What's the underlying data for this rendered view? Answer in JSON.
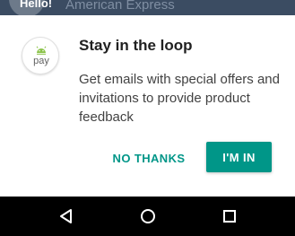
{
  "background_app": {
    "avatar_text": "Hello!",
    "title": "American Express"
  },
  "dialog": {
    "app_icon": "android-pay-icon",
    "app_icon_text": "pay",
    "title": "Stay in the loop",
    "message": "Get emails with special offers and invitations to provide product feedback",
    "decline_label": "NO THANKS",
    "accept_label": "I'M IN"
  },
  "nav_bar": {
    "back_icon": "back-triangle-icon",
    "home_icon": "home-circle-icon",
    "recents_icon": "recents-square-icon"
  },
  "colors": {
    "accent": "#009688",
    "title_text": "#212121",
    "body_text": "#424242",
    "nav_bar": "#000000",
    "android_green": "#8bc34a"
  }
}
